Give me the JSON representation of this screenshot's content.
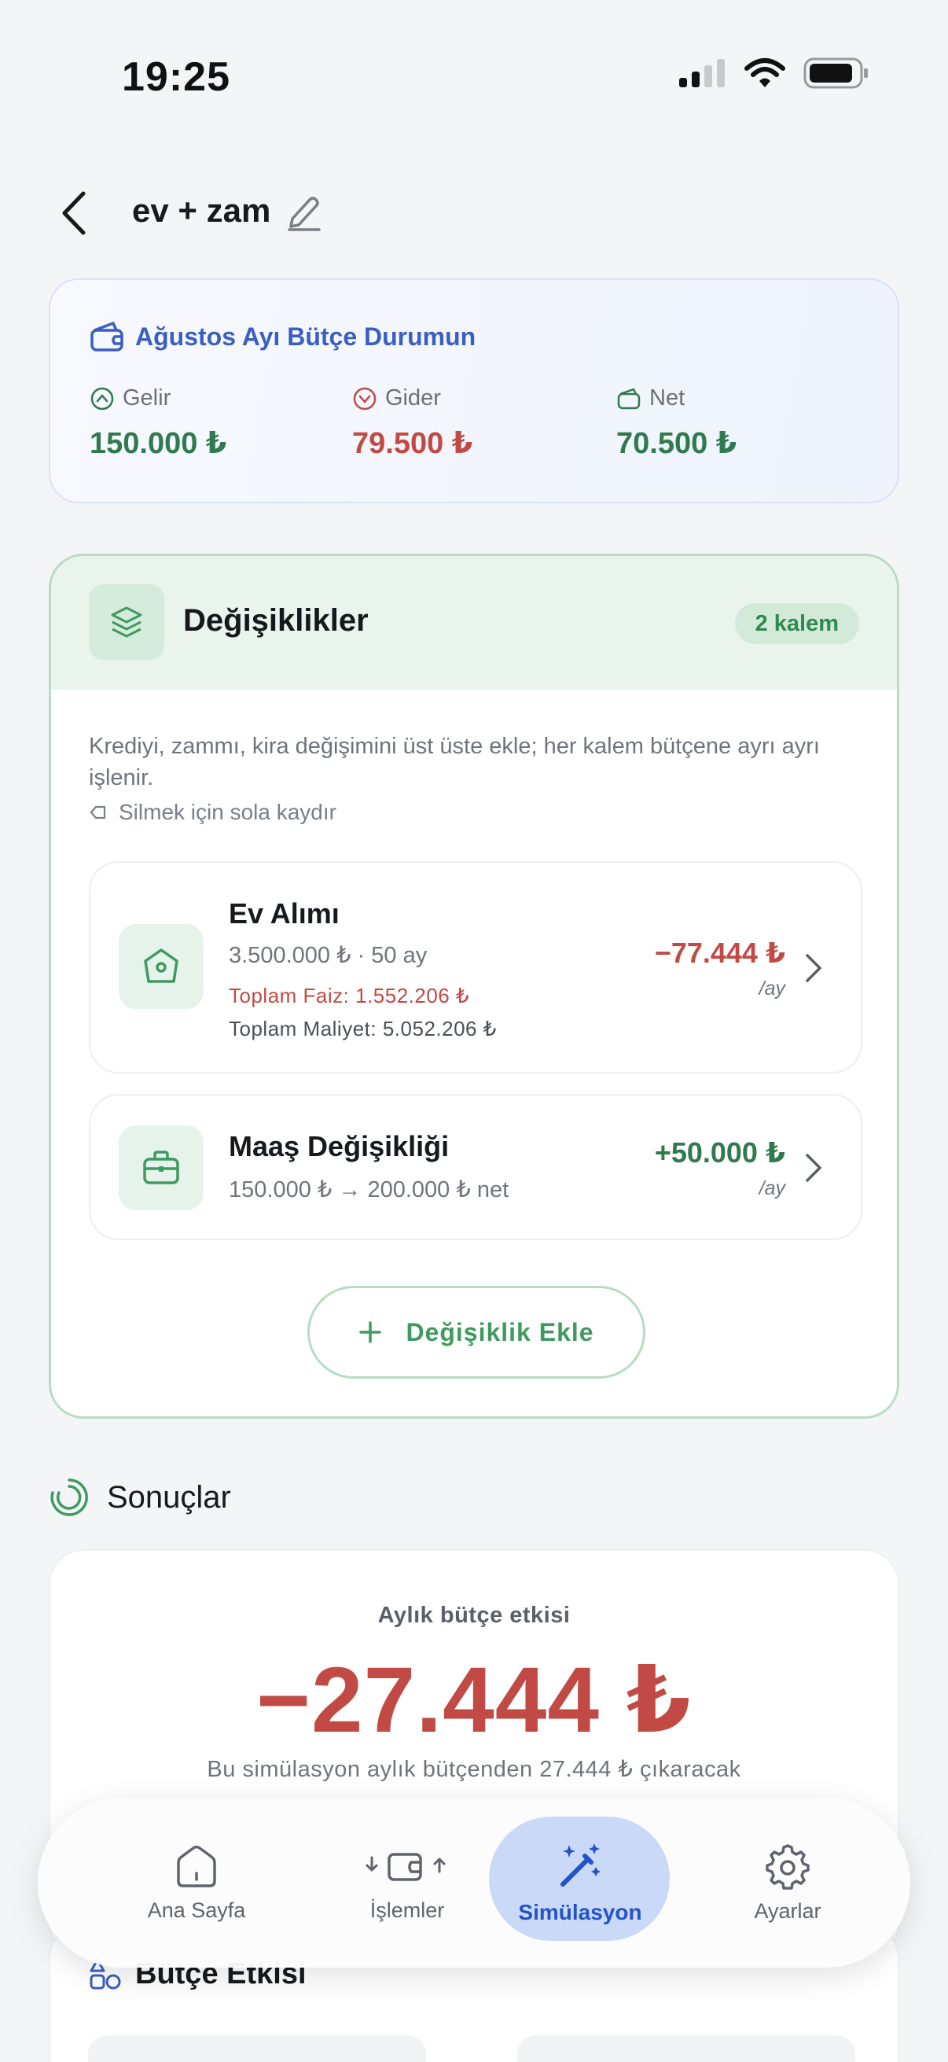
{
  "status_bar": {
    "time": "19:25"
  },
  "header": {
    "title": "ev + zam"
  },
  "summary": {
    "title": "Ağustos Ayı Bütçe Durumun",
    "income": {
      "label": "Gelir",
      "value": "150.000 ₺"
    },
    "expense": {
      "label": "Gider",
      "value": "79.500 ₺"
    },
    "net": {
      "label": "Net",
      "value": "70.500 ₺"
    }
  },
  "changes": {
    "title": "Değişiklikler",
    "count_badge": "2 kalem",
    "description": "Krediyi, zammı, kira değişimini üst üste ekle; her kalem bütçene ayrı ayrı işlenir.",
    "swipe_hint": "Silmek için sola kaydır",
    "items": [
      {
        "title": "Ev Alımı",
        "subtitle": "3.500.000 ₺ · 50 ay",
        "interest": "Toplam Faiz: 1.552.206 ₺",
        "total_cost": "Toplam Maliyet: 5.052.206 ₺",
        "amount": "−77.444 ₺",
        "per": "/ay"
      },
      {
        "title": "Maaş Değişikliği",
        "subtitle": "150.000 ₺ → 200.000 ₺ net",
        "amount": "+50.000 ₺",
        "per": "/ay"
      }
    ],
    "add_button": "Değişiklik Ekle"
  },
  "results": {
    "title": "Sonuçlar",
    "impact_label": "Aylık bütçe etkisi",
    "impact_value": "−27.444 ₺",
    "impact_desc": "Bu simülasyon aylık bütçenden 27.444 ₺ çıkaracak"
  },
  "budget_impact": {
    "title": "Bütçe Etkisi"
  },
  "nav": {
    "items": [
      {
        "label": "Ana Sayfa",
        "icon": "home-icon"
      },
      {
        "label": "İşlemler",
        "icon": "wallet-icon"
      },
      {
        "label": "Simülasyon",
        "icon": "magic-wand-icon",
        "active": true
      },
      {
        "label": "Ayarlar",
        "icon": "gear-icon"
      }
    ]
  },
  "colors": {
    "accent_blue": "#2552c8",
    "positive_green": "#2f7a4e",
    "negative_red": "#c24a45",
    "changes_border": "#b9dcc3"
  }
}
